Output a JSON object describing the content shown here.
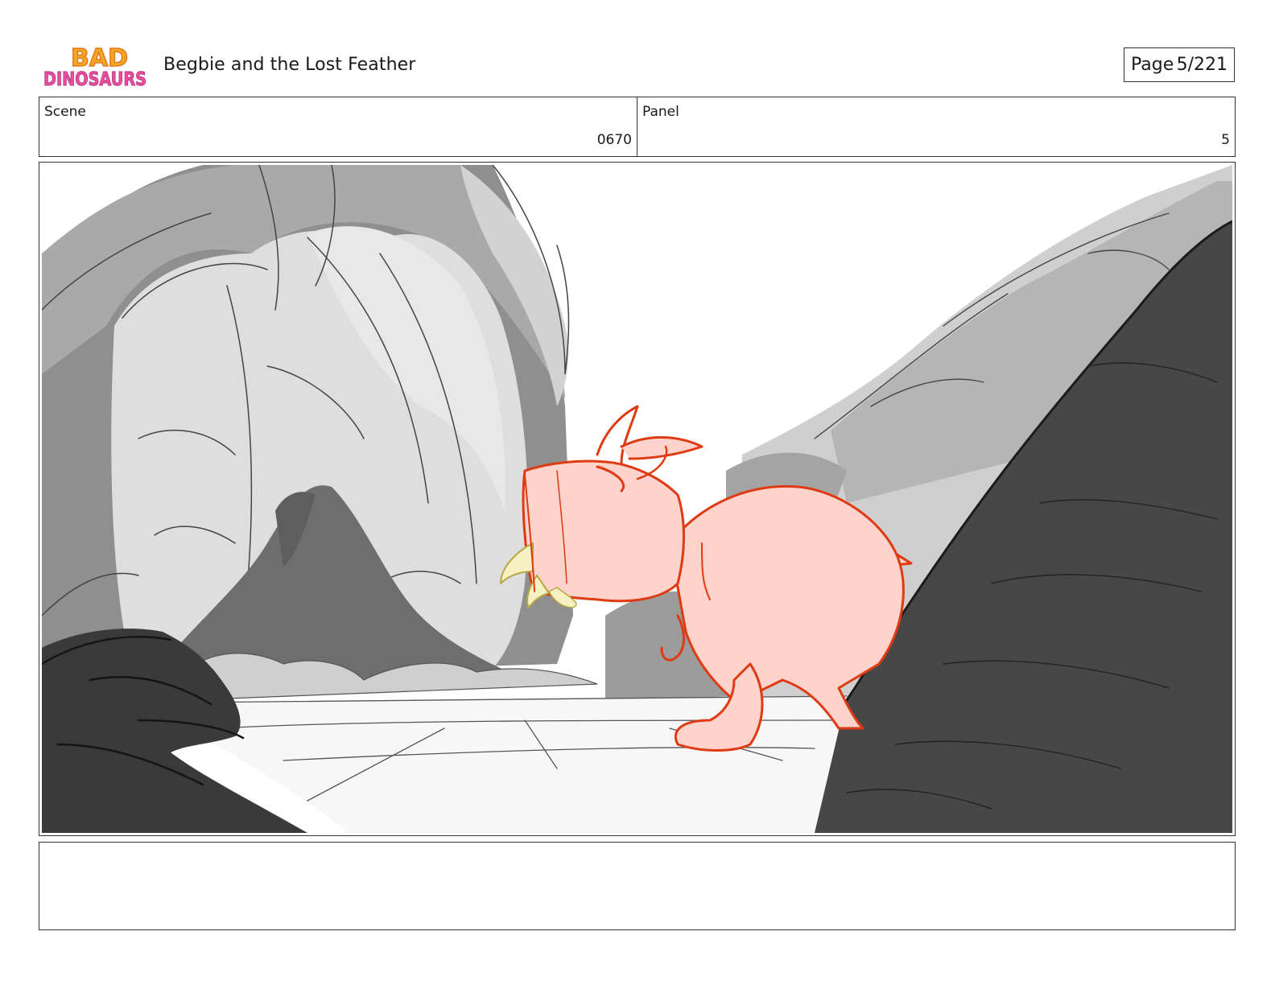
{
  "header": {
    "logo": {
      "line1": "BAD",
      "line2": "DINOSAURS"
    },
    "title": "Begbie and the Lost Feather",
    "page_label": "Page",
    "page_value": "5/221"
  },
  "info": {
    "scene_label": "Scene",
    "scene_value": "0670",
    "panel_label": "Panel",
    "panel_value": "5"
  },
  "panel": {
    "image": "storyboard-sketch",
    "colors": {
      "dino_fill": "#fdd3cc",
      "dino_line": "#e03a12",
      "rock_dark": "#4a4a4a",
      "rock_mid": "#8c8c8c",
      "rock_light": "#dcdcdc"
    }
  },
  "notes": {
    "text": ""
  }
}
